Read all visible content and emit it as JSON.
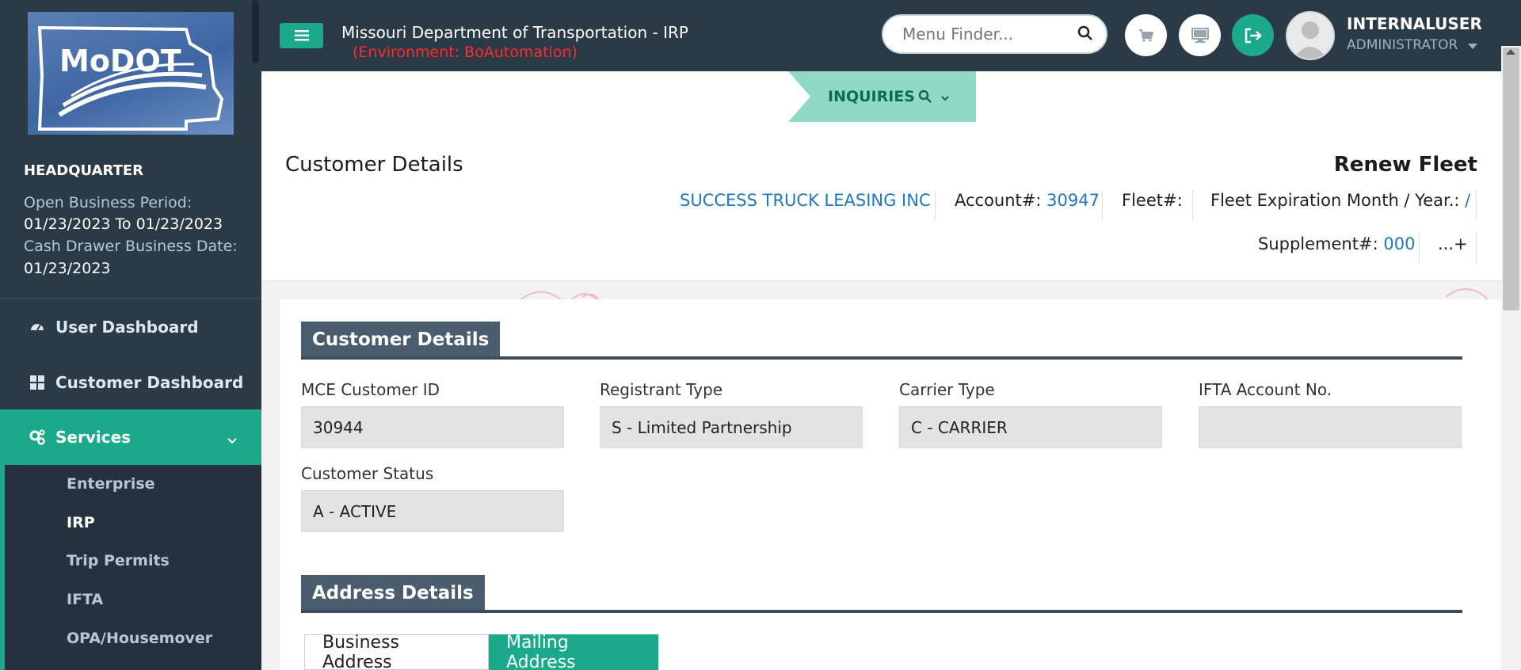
{
  "sidebar": {
    "logo_text": "MoDOT",
    "office": "HEADQUARTER",
    "open_business_period_label": "Open Business Period:",
    "open_business_period_value": "01/23/2023 To 01/23/2023",
    "cash_drawer_label": "Cash Drawer Business Date:",
    "cash_drawer_value": "01/23/2023",
    "nav": [
      {
        "label": "User Dashboard",
        "icon": "dashboard-icon"
      },
      {
        "label": "Customer Dashboard",
        "icon": "grid-icon"
      },
      {
        "label": "Services",
        "icon": "cogs-icon"
      }
    ],
    "services_sub": [
      "Enterprise",
      "IRP",
      "Trip Permits",
      "IFTA",
      "OPA/Housemover"
    ]
  },
  "header": {
    "app_title": "Missouri Department of Transportation - IRP",
    "environment": "(Environment: BoAutomation)",
    "menu_finder_placeholder": "Menu Finder...",
    "user_name": "INTERNALUSER",
    "user_role": "ADMINISTRATOR"
  },
  "inquiries": {
    "label": "INQUIRIES"
  },
  "page": {
    "title": "Customer Details",
    "action_title": "Renew Fleet",
    "company": "SUCCESS TRUCK LEASING INC",
    "account_label": "Account#:",
    "account_value": "30947",
    "fleet_label": "Fleet#:",
    "fleet_exp_label": "Fleet Expiration Month / Year.:",
    "fleet_exp_value": "/",
    "supplement_label": "Supplement#:",
    "supplement_value": "000",
    "more_label": "...+"
  },
  "customer_details": {
    "section_title": "Customer Details",
    "fields": [
      {
        "label": "MCE Customer ID",
        "value": "30944"
      },
      {
        "label": "Registrant Type",
        "value": "S - Limited Partnership"
      },
      {
        "label": "Carrier Type",
        "value": "C - CARRIER"
      },
      {
        "label": "IFTA Account No.",
        "value": ""
      },
      {
        "label": "Customer Status",
        "value": "A - ACTIVE"
      }
    ]
  },
  "address_details": {
    "section_title": "Address Details",
    "tabs": [
      "Business Address",
      "Mailing Address"
    ],
    "active_tab": "Mailing Address"
  },
  "colors": {
    "sidebar_bg": "#2b3a47",
    "accent_green": "#1aa98a",
    "link_blue": "#2077c0",
    "env_red": "#ff2a2a",
    "section_header": "#4a5d6e"
  }
}
